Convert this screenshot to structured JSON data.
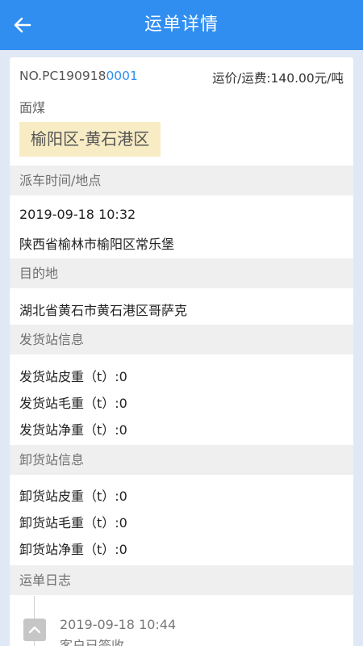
{
  "header": {
    "title": "运单详情",
    "back_icon": "arrow-left-icon"
  },
  "order": {
    "no_prefix": "NO.PC190918",
    "no_highlight": "0001",
    "price": "运价/运费:140.00元/吨",
    "cargo": "面煤",
    "route": "榆阳区-黄石港区"
  },
  "dispatch": {
    "heading": "派车时间/地点",
    "time": "2019-09-18 10:32",
    "place": "陕西省榆林市榆阳区常乐堡"
  },
  "destination": {
    "heading": "目的地",
    "place": "湖北省黄石市黄石港区哥萨克"
  },
  "send_station": {
    "heading": "发货站信息",
    "lines": [
      "发货站皮重（t）:0",
      "发货站毛重（t）:0",
      "发货站净重（t）:0"
    ]
  },
  "unload_station": {
    "heading": "卸货站信息",
    "lines": [
      "卸货站皮重（t）:0",
      "卸货站毛重（t）:0",
      "卸货站净重（t）:0"
    ]
  },
  "log": {
    "heading": "运单日志",
    "entries": [
      {
        "time": "2019-09-18 10:44",
        "text": "客户已签收",
        "icon": "chevron-up-icon"
      }
    ]
  },
  "colors": {
    "header": "#2f8ef0",
    "accent": "#2f8ef0",
    "route_tag_bg": "#f8ecc5",
    "page_bg": "#dfe8f4"
  }
}
